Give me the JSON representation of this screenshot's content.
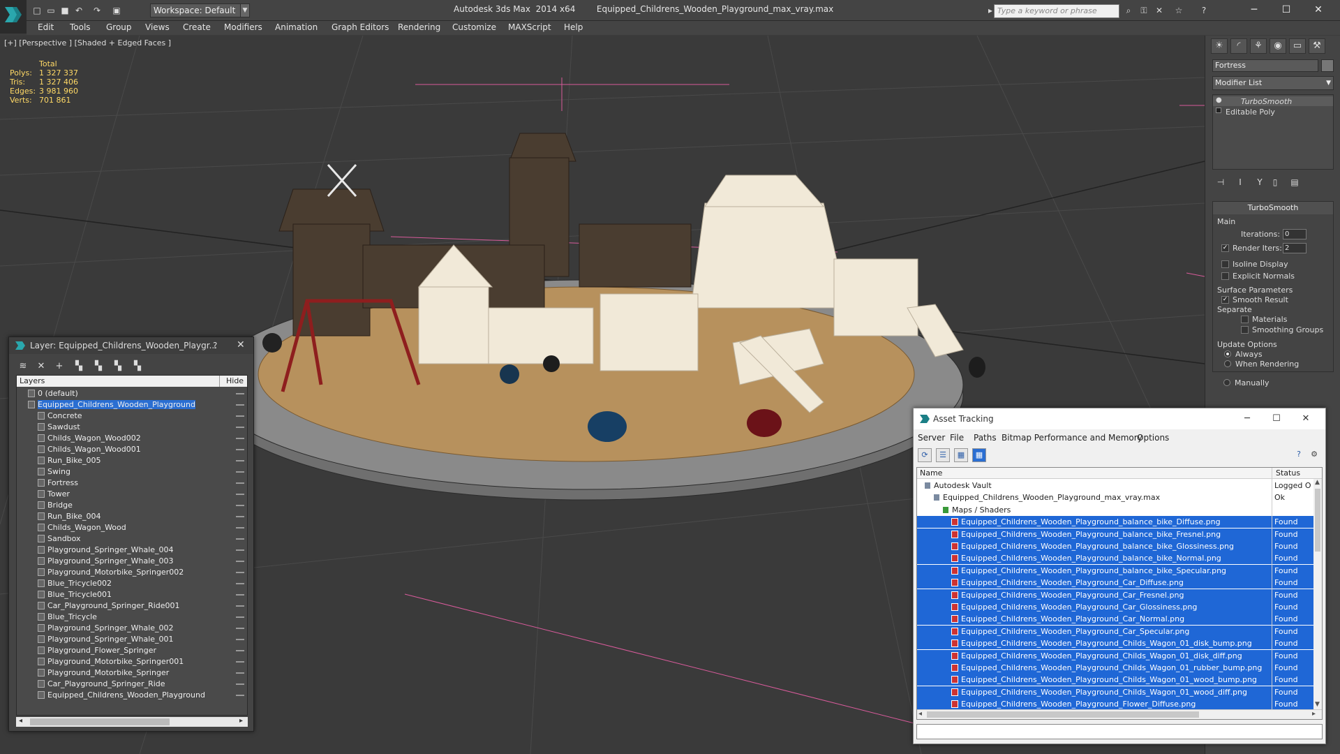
{
  "titlebar": {
    "workspace": "Workspace: Default",
    "app_name": "Autodesk 3ds Max  2014 x64",
    "file_name": "Equipped_Childrens_Wooden_Playground_max_vray.max",
    "search_placeholder": "Type a keyword or phrase"
  },
  "menu": [
    "Edit",
    "Tools",
    "Group",
    "Views",
    "Create",
    "Modifiers",
    "Animation",
    "Graph Editors",
    "Rendering",
    "Customize",
    "MAXScript",
    "Help"
  ],
  "viewport": {
    "label": "[+] [Perspective ] [Shaded + Edged Faces ]",
    "stats": {
      "total_label": "Total",
      "polys_label": "Polys:",
      "polys": "1 327 337",
      "tris_label": "Tris:",
      "tris": "1 327 406",
      "edges_label": "Edges:",
      "edges": "3 981 960",
      "verts_label": "Verts:",
      "verts": "701 861"
    }
  },
  "command_panel": {
    "object_name": "Fortress",
    "modifier_list": "Modifier List",
    "stack": [
      "TurboSmooth",
      "Editable Poly"
    ],
    "rollout": {
      "title": "TurboSmooth",
      "main": "Main",
      "iterations_label": "Iterations:",
      "iterations": "0",
      "render_iters_label": "Render Iters:",
      "render_iters": "2",
      "isoline": "Isoline Display",
      "explicit": "Explicit Normals",
      "surface": "Surface Parameters",
      "smooth_result": "Smooth Result",
      "separate": "Separate",
      "materials": "Materials",
      "smoothing_groups": "Smoothing Groups",
      "update_options": "Update Options",
      "always": "Always",
      "when_rendering": "When Rendering",
      "manually": "Manually"
    }
  },
  "layer_dialog": {
    "title": "Layer: Equipped_Childrens_Wooden_Playgr...",
    "help": "?",
    "col_layers": "Layers",
    "col_hide": "Hide",
    "layers": [
      {
        "name": "0 (default)",
        "level": 1
      },
      {
        "name": "Equipped_Childrens_Wooden_Playground",
        "level": 1,
        "selected": true
      },
      {
        "name": "Concrete",
        "level": 2
      },
      {
        "name": "Sawdust",
        "level": 2
      },
      {
        "name": "Childs_Wagon_Wood002",
        "level": 2
      },
      {
        "name": "Childs_Wagon_Wood001",
        "level": 2
      },
      {
        "name": "Run_Bike_005",
        "level": 2
      },
      {
        "name": "Swing",
        "level": 2
      },
      {
        "name": "Fortress",
        "level": 2
      },
      {
        "name": "Tower",
        "level": 2
      },
      {
        "name": "Bridge",
        "level": 2
      },
      {
        "name": "Run_Bike_004",
        "level": 2
      },
      {
        "name": "Childs_Wagon_Wood",
        "level": 2
      },
      {
        "name": "Sandbox",
        "level": 2
      },
      {
        "name": "Playground_Springer_Whale_004",
        "level": 2
      },
      {
        "name": "Playground_Springer_Whale_003",
        "level": 2
      },
      {
        "name": "Playground_Motorbike_Springer002",
        "level": 2
      },
      {
        "name": "Blue_Tricycle002",
        "level": 2
      },
      {
        "name": "Blue_Tricycle001",
        "level": 2
      },
      {
        "name": "Car_Playground_Springer_Ride001",
        "level": 2
      },
      {
        "name": "Blue_Tricycle",
        "level": 2
      },
      {
        "name": "Playground_Springer_Whale_002",
        "level": 2
      },
      {
        "name": "Playground_Springer_Whale_001",
        "level": 2
      },
      {
        "name": "Playground_Flower_Springer",
        "level": 2
      },
      {
        "name": "Playground_Motorbike_Springer001",
        "level": 2
      },
      {
        "name": "Playground_Motorbike_Springer",
        "level": 2
      },
      {
        "name": "Car_Playground_Springer_Ride",
        "level": 2
      },
      {
        "name": "Equipped_Childrens_Wooden_Playground",
        "level": 2
      }
    ]
  },
  "asset_dialog": {
    "title": "Asset Tracking",
    "menu": [
      "Server",
      "File",
      "Paths",
      "Bitmap Performance and Memory",
      "Options"
    ],
    "col_name": "Name",
    "col_status": "Status",
    "rows": [
      {
        "name": "Autodesk Vault",
        "status": "Logged O",
        "level": 0,
        "kind": "vault"
      },
      {
        "name": "Equipped_Childrens_Wooden_Playground_max_vray.max",
        "status": "Ok",
        "level": 1,
        "kind": "max"
      },
      {
        "name": "Maps / Shaders",
        "status": "",
        "level": 2,
        "kind": "folder"
      },
      {
        "name": "Equipped_Childrens_Wooden_Playground_balance_bike_Diffuse.png",
        "status": "Found",
        "level": 3,
        "kind": "file"
      },
      {
        "name": "Equipped_Childrens_Wooden_Playground_balance_bike_Fresnel.png",
        "status": "Found",
        "level": 3,
        "kind": "file"
      },
      {
        "name": "Equipped_Childrens_Wooden_Playground_balance_bike_Glossiness.png",
        "status": "Found",
        "level": 3,
        "kind": "file"
      },
      {
        "name": "Equipped_Childrens_Wooden_Playground_balance_bike_Normal.png",
        "status": "Found",
        "level": 3,
        "kind": "file"
      },
      {
        "name": "Equipped_Childrens_Wooden_Playground_balance_bike_Specular.png",
        "status": "Found",
        "level": 3,
        "kind": "file"
      },
      {
        "name": "Equipped_Childrens_Wooden_Playground_Car_Diffuse.png",
        "status": "Found",
        "level": 3,
        "kind": "file"
      },
      {
        "name": "Equipped_Childrens_Wooden_Playground_Car_Fresnel.png",
        "status": "Found",
        "level": 3,
        "kind": "file"
      },
      {
        "name": "Equipped_Childrens_Wooden_Playground_Car_Glossiness.png",
        "status": "Found",
        "level": 3,
        "kind": "file"
      },
      {
        "name": "Equipped_Childrens_Wooden_Playground_Car_Normal.png",
        "status": "Found",
        "level": 3,
        "kind": "file"
      },
      {
        "name": "Equipped_Childrens_Wooden_Playground_Car_Specular.png",
        "status": "Found",
        "level": 3,
        "kind": "file"
      },
      {
        "name": "Equipped_Childrens_Wooden_Playground_Childs_Wagon_01_disk_bump.png",
        "status": "Found",
        "level": 3,
        "kind": "file"
      },
      {
        "name": "Equipped_Childrens_Wooden_Playground_Childs_Wagon_01_disk_diff.png",
        "status": "Found",
        "level": 3,
        "kind": "file"
      },
      {
        "name": "Equipped_Childrens_Wooden_Playground_Childs_Wagon_01_rubber_bump.png",
        "status": "Found",
        "level": 3,
        "kind": "file"
      },
      {
        "name": "Equipped_Childrens_Wooden_Playground_Childs_Wagon_01_wood_bump.png",
        "status": "Found",
        "level": 3,
        "kind": "file"
      },
      {
        "name": "Equipped_Childrens_Wooden_Playground_Childs_Wagon_01_wood_diff.png",
        "status": "Found",
        "level": 3,
        "kind": "file"
      },
      {
        "name": "Equipped_Childrens_Wooden_Playground_Flower_Diffuse.png",
        "status": "Found",
        "level": 3,
        "kind": "file"
      }
    ]
  },
  "colors": {
    "accent": "#2a6ed2",
    "selection_row": "#1f67d6",
    "stats_text": "#ffd966",
    "viewport_bg": "#3a3a3a"
  }
}
